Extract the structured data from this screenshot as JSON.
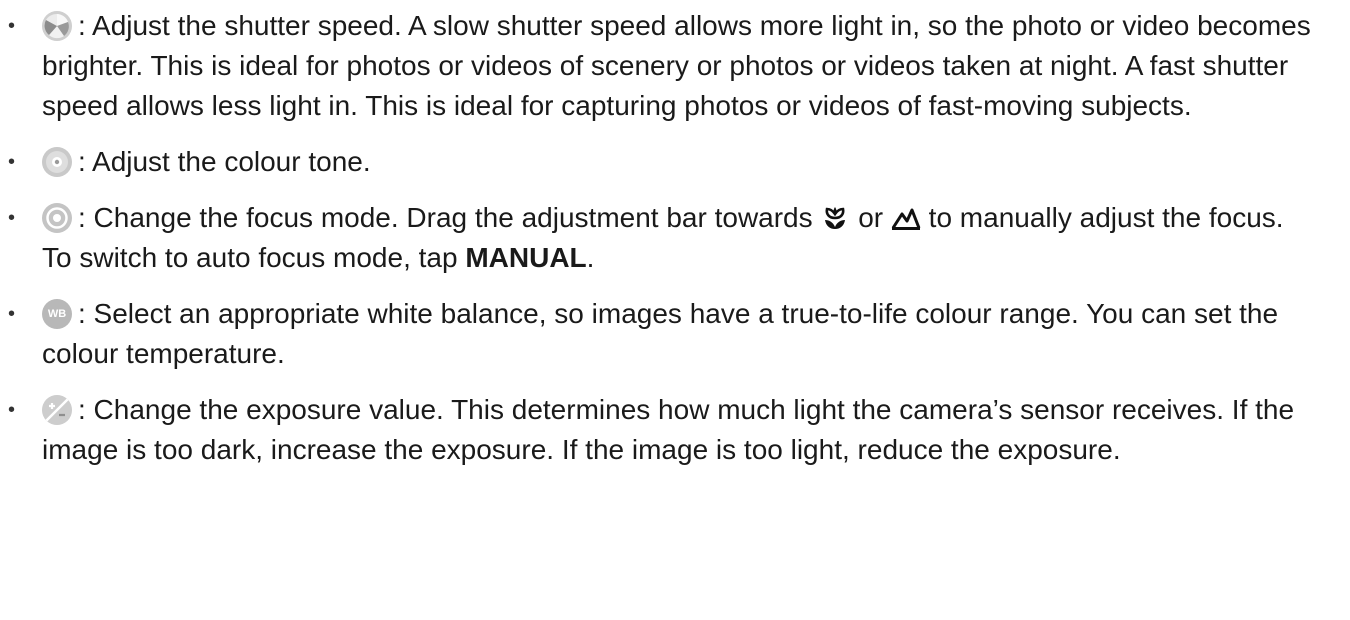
{
  "items": [
    {
      "icon": "shutter-speed-icon",
      "text": ": Adjust the shutter speed. A slow shutter speed allows more light in, so the photo or video becomes brighter. This is ideal for photos or videos of scenery or photos or videos taken at night. A fast shutter speed allows less light in. This is ideal for capturing photos or videos of fast-moving subjects."
    },
    {
      "icon": "colour-tone-icon",
      "text": ": Adjust the colour tone."
    },
    {
      "icon": "focus-mode-icon",
      "text_a": ": Change the focus mode. Drag the adjustment bar towards",
      "macro_icon": "macro-flower-icon",
      "text_or": "or",
      "landscape_icon": "landscape-mountain-icon",
      "text_b": "to manually adjust the focus. To switch to auto focus mode, tap",
      "bold": "MANUAL",
      "text_end": "."
    },
    {
      "icon": "white-balance-icon",
      "icon_label": "WB",
      "text": ": Select an appropriate white balance, so images have a true-to-life colour range. You can set the colour temperature."
    },
    {
      "icon": "exposure-icon",
      "text": ": Change the exposure value. This determines how much light the camera’s sensor receives. If the image is too dark, increase the exposure. If the image is too light, reduce the exposure."
    }
  ]
}
